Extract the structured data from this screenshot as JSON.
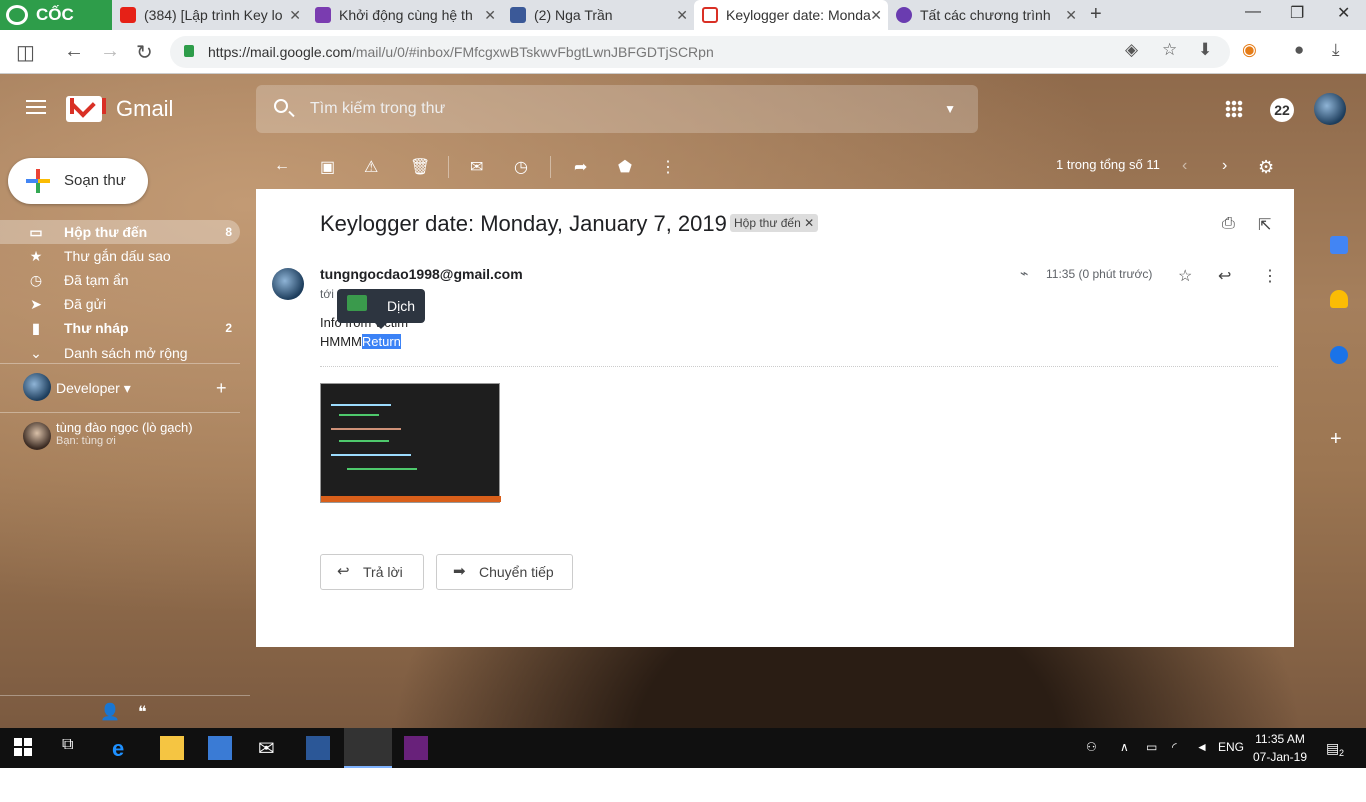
{
  "browser": {
    "brand": "CỐC CỐC",
    "tabs": [
      {
        "title": "(384) [Lập trình Key lo"
      },
      {
        "title": "Khởi động cùng hệ th"
      },
      {
        "title": "(2) Nga Trần"
      },
      {
        "title": "Keylogger date: Monda"
      },
      {
        "title": "Tất các chương trình"
      }
    ],
    "url_main": "https://mail.google.com",
    "url_rest": "/mail/u/0/#inbox/FMfcgxwBTskwvFbgtLwnJBFGDTjSCRpn"
  },
  "gmail": {
    "app_name": "Gmail",
    "search_placeholder": "Tìm kiếm trong thư",
    "notifications": "22",
    "compose": "Soạn thư",
    "nav": [
      {
        "label": "Hộp thư đến",
        "count": "8"
      },
      {
        "label": "Thư gắn dấu sao",
        "count": ""
      },
      {
        "label": "Đã tạm ẩn",
        "count": ""
      },
      {
        "label": "Đã gửi",
        "count": ""
      },
      {
        "label": "Thư nháp",
        "count": "2"
      },
      {
        "label": "Danh sách mở rộng",
        "count": ""
      }
    ],
    "hangouts_user": "Developer",
    "contact_name": "tùng đào ngọc (lò gạch)",
    "contact_status": "Bạn: tùng ơi",
    "pager": "1 trong tổng số 11"
  },
  "message": {
    "subject": "Keylogger date: Monday, January 7, 2019",
    "label": "Hộp thư đến",
    "sender": "tungngocdao1998@gmail.com",
    "to": "tới",
    "time": "11:35 (0 phút trước)",
    "body_line1": "Info from victim",
    "body_line2_prefix": "HMMM",
    "body_line2_selected": "Return",
    "translate_tooltip": "Dịch",
    "reply": "Trả lời",
    "forward": "Chuyển tiếp"
  },
  "taskbar": {
    "time": "11:35 AM",
    "date": "07-Jan-19",
    "lang": "ENG",
    "notif_count": "2"
  }
}
